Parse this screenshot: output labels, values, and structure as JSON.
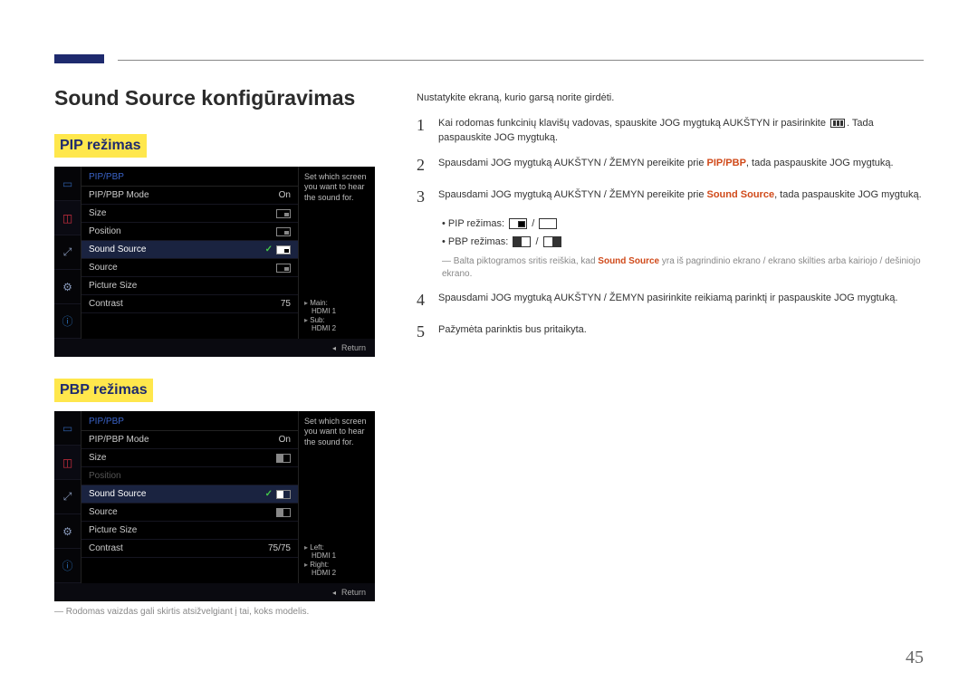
{
  "page": {
    "title": "Sound Source konfigūravimas",
    "mode_pip_label": "PIP režimas",
    "mode_pbp_label": "PBP režimas",
    "page_number": "45"
  },
  "osd": {
    "header": "PIP/PBP",
    "desc_text": "Set which screen you want to hear the sound for.",
    "return_label": "Return",
    "rows": {
      "mode": "PIP/PBP Mode",
      "mode_val": "On",
      "size": "Size",
      "position": "Position",
      "sound": "Sound Source",
      "source": "Source",
      "picsize": "Picture Size",
      "contrast": "Contrast",
      "contrast_val_pip": "75",
      "contrast_val_pbp": "75/75"
    },
    "meta_pip": {
      "l1": "Main:",
      "v1": "HDMI 1",
      "l2": "Sub:",
      "v2": "HDMI 2"
    },
    "meta_pbp": {
      "l1": "Left:",
      "v1": "HDMI 1",
      "l2": "Right:",
      "v2": "HDMI 2"
    }
  },
  "footnote_img": "Rodomas vaizdas gali skirtis atsižvelgiant į tai, koks modelis.",
  "right": {
    "intro": "Nustatykite ekraną, kurio garsą norite girdėti.",
    "step1a": "Kai rodomas funkcinių klavišų vadovas, spauskite JOG mygtuką AUKŠTYN ir pasirinkite",
    "step1b": ". Tada paspauskite JOG mygtuką.",
    "step2a": "Spausdami JOG mygtuką AUKŠTYN / ŽEMYN pereikite prie ",
    "step2hl": "PIP/PBP",
    "step2b": ", tada paspauskite JOG mygtuką.",
    "step3a": "Spausdami JOG mygtuką AUKŠTYN / ŽEMYN pereikite prie ",
    "step3hl": "Sound Source",
    "step3b": ", tada paspauskite JOG mygtuką.",
    "bullet_pip": "PIP režimas: ",
    "bullet_pbp": "PBP režimas: ",
    "note_a": "Balta piktogramos sritis reiškia, kad ",
    "note_hl": "Sound Source",
    "note_b": " yra iš pagrindinio ekrano / ekrano skilties arba kairiojo / dešiniojo ekrano.",
    "step4": "Spausdami JOG mygtuką AUKŠTYN / ŽEMYN pasirinkite reikiamą parinktį ir paspauskite JOG mygtuką.",
    "step5": "Pažymėta parinktis bus pritaikyta."
  }
}
